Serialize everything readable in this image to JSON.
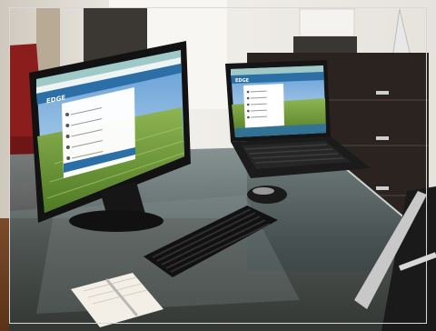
{
  "photo": {
    "monitor_screen": {
      "logo_text": "EDGE",
      "menu_items_count": 5,
      "colors": {
        "title_bar": "#9ec9c6",
        "header": "#2c6fa7",
        "sky": "#8bbbe2",
        "field": "#7fa84a"
      }
    },
    "laptop_screen": {
      "logo_text": "EDGE",
      "colors": {
        "title_bar": "#9ec9c6",
        "header": "#2c6fa7",
        "sky": "#7fb1db",
        "field": "#6f9a3b"
      }
    },
    "colors": {
      "wall": "#e9e6df",
      "desk_glass": "#4f5a5a",
      "cabinet": "#2b2320",
      "chair_red": "#8b1d1d",
      "hardware": "#151515"
    }
  }
}
